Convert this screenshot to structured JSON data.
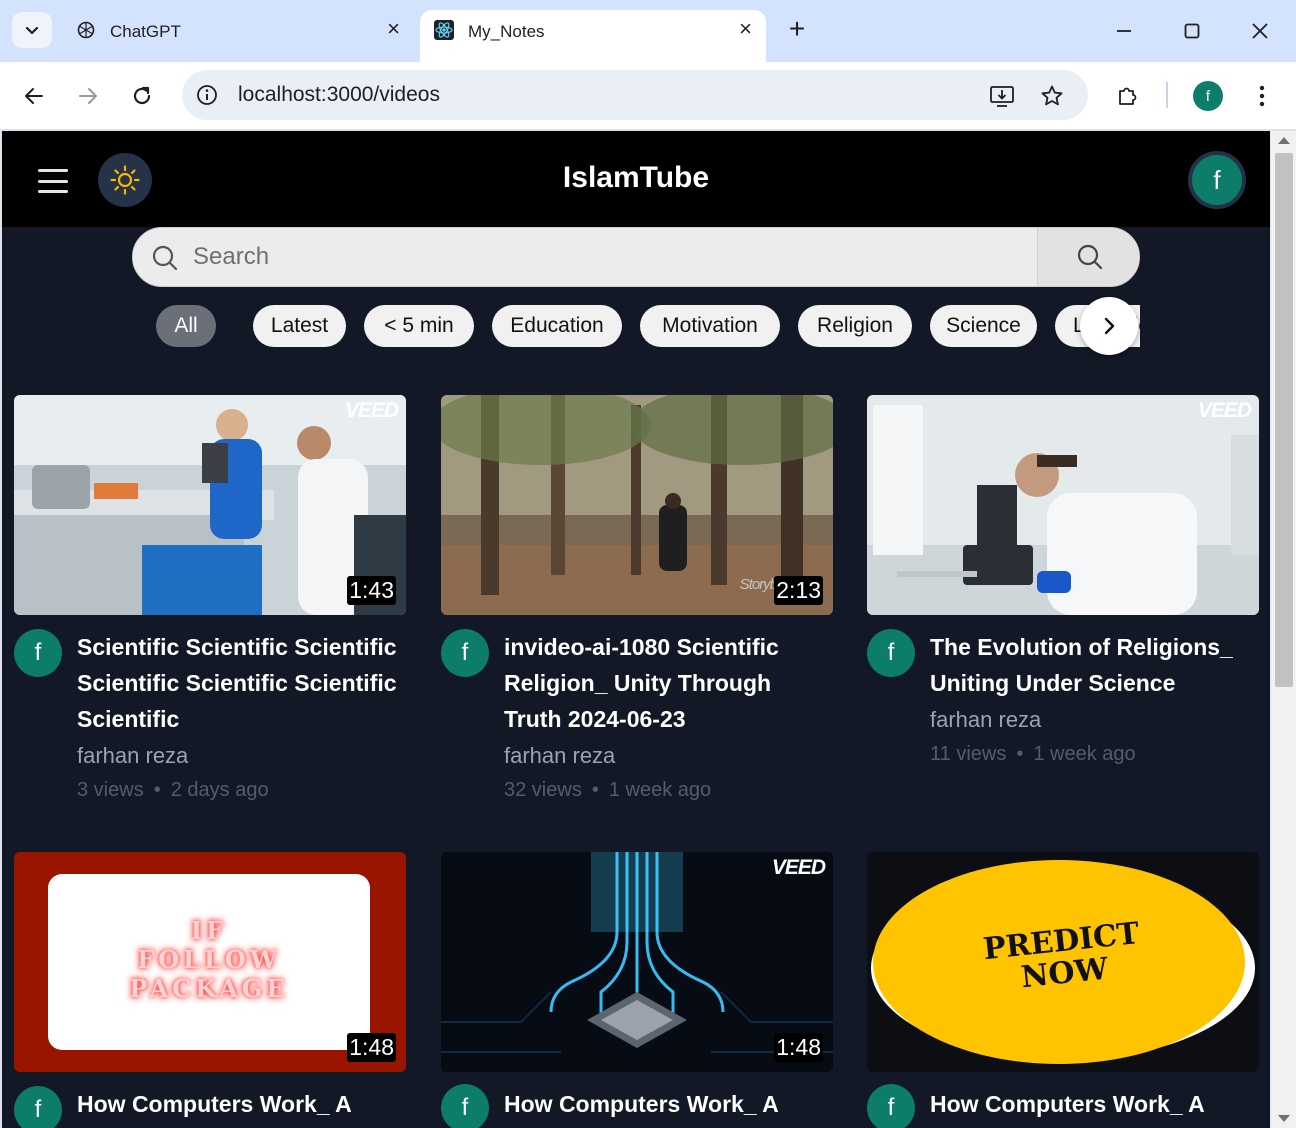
{
  "browser": {
    "tabs": [
      {
        "title": "ChatGPT",
        "icon": "chatgpt-icon",
        "active": false
      },
      {
        "title": "My_Notes",
        "icon": "react-icon",
        "active": true
      }
    ],
    "url": "localhost:3000/videos",
    "profile_initial": "f"
  },
  "app": {
    "brand": "IslamTube",
    "avatar_initial": "f",
    "accent_color": "#0b7d68"
  },
  "search": {
    "placeholder": "Search",
    "value": ""
  },
  "chips": [
    "All",
    "Latest",
    "< 5 min",
    "Education",
    "Motivation",
    "Religion",
    "Science",
    "Lifestyle"
  ],
  "active_chip": "All",
  "videos": [
    {
      "title": "Scientific Scientific Scientific Scientific Scientific Scientific Scientific",
      "channel": "farhan reza",
      "views": "3 views",
      "age": "2 days ago",
      "duration": "1:43",
      "watermark": "VEED",
      "avatar": "f"
    },
    {
      "title": "invideo-ai-1080 Scientific Religion_ Unity Through Truth 2024-06-23",
      "channel": "farhan reza",
      "views": "32 views",
      "age": "1 week ago",
      "duration": "2:13",
      "watermark": "Storyb",
      "avatar": "f"
    },
    {
      "title": "The Evolution of Religions_ Uniting Under Science",
      "channel": "farhan reza",
      "views": "11 views",
      "age": "1 week ago",
      "duration": "",
      "watermark": "VEED",
      "avatar": "f"
    },
    {
      "title": "How Computers Work_ A",
      "channel": "",
      "views": "",
      "age": "",
      "duration": "1:48",
      "thumb_text": [
        "IF",
        "FOLLOW",
        "PACKAGE"
      ],
      "avatar": "f"
    },
    {
      "title": "How Computers Work_ A",
      "channel": "",
      "views": "",
      "age": "",
      "duration": "1:48",
      "watermark": "VEED",
      "avatar": "f"
    },
    {
      "title": "How Computers Work_ A",
      "channel": "",
      "views": "",
      "age": "",
      "duration": "",
      "thumb_text": [
        "PREDICT",
        "NOW"
      ],
      "avatar": "f"
    }
  ]
}
